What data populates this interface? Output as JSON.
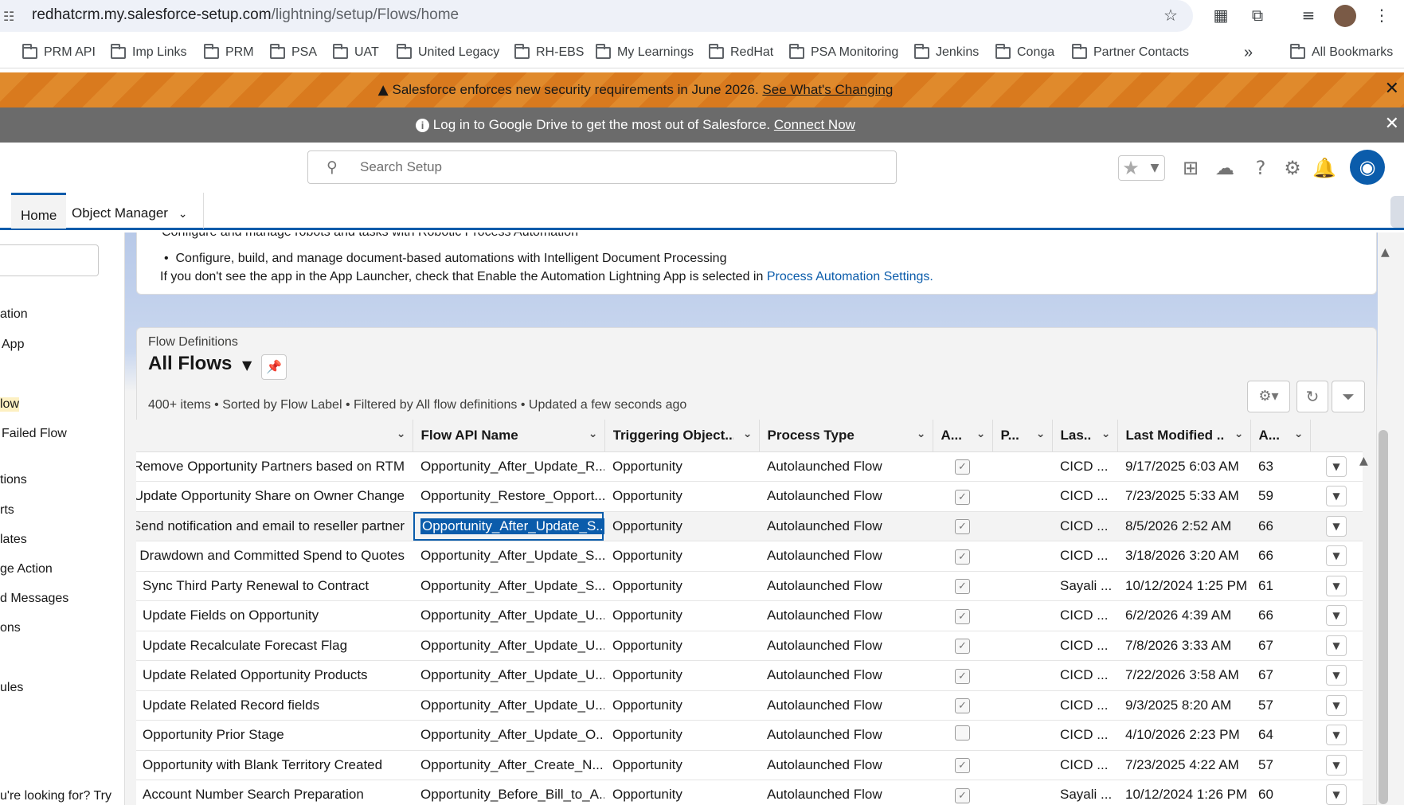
{
  "browser": {
    "url_host": "redhatcrm.my.salesforce-setup.com",
    "url_path": "/lightning/setup/Flows/home",
    "bookmarks": [
      "PRM API",
      "Imp Links",
      "PRM",
      "PSA",
      "UAT",
      "United Legacy",
      "RH-EBS",
      "My Learnings",
      "RedHat",
      "PSA Monitoring",
      "Jenkins",
      "Conga",
      "Partner Contacts"
    ],
    "more_bookmarks": "»",
    "all_bookmarks": "All Bookmarks"
  },
  "banners": {
    "security_text": "Salesforce enforces new security requirements in June 2026.",
    "security_link": "See What's Changing",
    "drive_text": "Log in to Google Drive to get the most out of Salesforce.",
    "drive_link": "Connect Now",
    "close": "✕"
  },
  "header": {
    "search_placeholder": "Search Setup"
  },
  "nav": {
    "home": "Home",
    "object_manager": "Object Manager"
  },
  "sidebar": {
    "items": [
      "ation",
      "App",
      "low",
      "Failed Flow",
      "tions",
      "rts",
      "lates",
      "ge Action",
      "d Messages",
      "ons",
      "ules"
    ],
    "bottom_text": "u're looking for? Try"
  },
  "info": {
    "bullet_1": "Configure and manage robots and tasks with Robotic Process Automation",
    "bullet_2": "Configure, build, and manage document-based automations with Intelligent Document Processing",
    "line_3_prefix": "If you don't see the app in the App Launcher, check that Enable the Automation Lightning App is selected in",
    "line_3_link": "Process Automation Settings."
  },
  "list_view": {
    "object_label": "Flow Definitions",
    "title": "All Flows",
    "meta": "400+ items • Sorted by Flow Label • Filtered by All flow definitions • Updated a few seconds ago",
    "columns": [
      "",
      "Flow API Name",
      "Triggering Object...",
      "Process Type",
      "A...",
      "P...",
      "Las...",
      "Last Modified ...",
      "A..."
    ],
    "rows": [
      {
        "label": "Remove Opportunity Partners based on RTM",
        "api": "Opportunity_After_Update_R...",
        "object": "Opportunity",
        "type": "Autolaunched Flow",
        "active": true,
        "by": "CICD ...",
        "modified": "9/17/2025 6:03 AM",
        "ver": "63"
      },
      {
        "label": "Update Opportunity Share on Owner Change",
        "api": "Opportunity_Restore_Opport...",
        "object": "Opportunity",
        "type": "Autolaunched Flow",
        "active": true,
        "by": "CICD ...",
        "modified": "7/23/2025 5:33 AM",
        "ver": "59"
      },
      {
        "label": "Send notification and email to reseller partner",
        "api": "Opportunity_After_Update_S...",
        "object": "Opportunity",
        "type": "Autolaunched Flow",
        "active": true,
        "by": "CICD ...",
        "modified": "8/5/2026 2:52 AM",
        "ver": "66"
      },
      {
        "label": "Sync Drawdown and Committed Spend to Quotes",
        "api": "Opportunity_After_Update_S...",
        "object": "Opportunity",
        "type": "Autolaunched Flow",
        "active": true,
        "by": "CICD ...",
        "modified": "3/18/2026 3:20 AM",
        "ver": "66"
      },
      {
        "label": "Sync Third Party Renewal to Contract",
        "api": "Opportunity_After_Update_S...",
        "object": "Opportunity",
        "type": "Autolaunched Flow",
        "active": true,
        "by": "Sayali ...",
        "modified": "10/12/2024 1:25 PM",
        "ver": "61"
      },
      {
        "label": "Update Fields on Opportunity",
        "api": "Opportunity_After_Update_U...",
        "object": "Opportunity",
        "type": "Autolaunched Flow",
        "active": true,
        "by": "CICD ...",
        "modified": "6/2/2026 4:39 AM",
        "ver": "66"
      },
      {
        "label": "Update Recalculate Forecast Flag",
        "api": "Opportunity_After_Update_U...",
        "object": "Opportunity",
        "type": "Autolaunched Flow",
        "active": true,
        "by": "CICD ...",
        "modified": "7/8/2026 3:33 AM",
        "ver": "67"
      },
      {
        "label": "Update Related Opportunity Products",
        "api": "Opportunity_After_Update_U...",
        "object": "Opportunity",
        "type": "Autolaunched Flow",
        "active": true,
        "by": "CICD ...",
        "modified": "7/22/2026 3:58 AM",
        "ver": "67"
      },
      {
        "label": "Update Related Record fields",
        "api": "Opportunity_After_Update_U...",
        "object": "Opportunity",
        "type": "Autolaunched Flow",
        "active": true,
        "by": "CICD ...",
        "modified": "9/3/2025 8:20 AM",
        "ver": "57"
      },
      {
        "label": "Opportunity Prior Stage",
        "api": "Opportunity_After_Update_O...",
        "object": "Opportunity",
        "type": "Autolaunched Flow",
        "active": false,
        "by": "CICD ...",
        "modified": "4/10/2026 2:23 PM",
        "ver": "64"
      },
      {
        "label": "Opportunity with Blank Territory Created",
        "api": "Opportunity_After_Create_N...",
        "object": "Opportunity",
        "type": "Autolaunched Flow",
        "active": true,
        "by": "CICD ...",
        "modified": "7/23/2025 4:22 AM",
        "ver": "57"
      },
      {
        "label": "Account Number Search Preparation",
        "api": "Opportunity_Before_Bill_to_A...",
        "object": "Opportunity",
        "type": "Autolaunched Flow",
        "active": true,
        "by": "Sayali ...",
        "modified": "10/12/2024 1:26 PM",
        "ver": "60"
      }
    ]
  },
  "colors": {
    "brand": "#0b5cab",
    "warning_banner": "#e08a2c",
    "info_banner": "#6b6b6b"
  }
}
